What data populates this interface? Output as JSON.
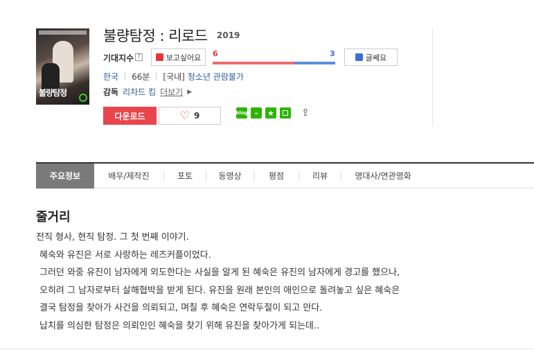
{
  "movie": {
    "title": "불량탐정 : 리로드",
    "year": "2019",
    "poster_title": "불량탐정"
  },
  "rating": {
    "label": "기대지수",
    "help": "?",
    "like_label": "보고싶어요",
    "dislike_label": "글쎄요",
    "like_count": "6",
    "dislike_count": "3",
    "like_ratio": 0.667
  },
  "info": {
    "country": "한국",
    "runtime": "66분",
    "rating_prefix": "[국내]",
    "age_rating": "청소년 관람불가"
  },
  "director": {
    "label": "감독",
    "name": "리차드 킴",
    "more": "더보기"
  },
  "actions": {
    "download": "다운로드",
    "wish_count": "9"
  },
  "share": {
    "blog": "blog",
    "icons": [
      "blog-icon",
      "cafe-icon",
      "star-icon",
      "square-icon",
      "share-icon"
    ]
  },
  "tabs": [
    "주요정보",
    "배우/제작진",
    "포토",
    "동영상",
    "평점",
    "리뷰",
    "명대사/연관영화"
  ],
  "synopsis": {
    "heading": "줄거리",
    "lines": [
      "전직 형사, 현직 탐정. 그 첫 번째 이야기.",
      "혜숙와 유진은 서로 사랑하는 레즈커플이었다.",
      "그러던 와중 유진이 남자에게 외도한다는 사실을 알게 된 혜숙은 유진의 남자에게 경고를 했으나,",
      "오히려 그 남자로부터 살해협박을 받게 된다. 유진을 원래 본인의 애인으로 돌려놓고 싶은 혜숙은",
      "결국 탐정을 찾아가 사건을 의뢰되고, 며칠 후 혜숙은 연락두절이 되고 만다.",
      "납치를 의심한 탐정은 의뢰인인 혜숙을 찾기 위해 유진을 찾아가게 되는데.."
    ]
  },
  "colors": {
    "like": "#e7333a",
    "dislike": "#3b6fd4",
    "download": "#e9454c",
    "link": "#2c5aa0",
    "naver_green": "#2db400"
  }
}
